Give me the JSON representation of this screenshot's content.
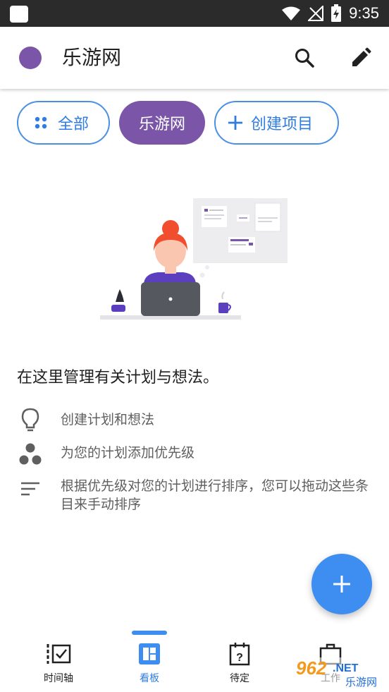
{
  "status_bar": {
    "time": "9:35"
  },
  "app_bar": {
    "title": "乐游网",
    "project_color": "#7b56a8",
    "search_icon": "search-icon",
    "edit_icon": "pencil-icon"
  },
  "chips": {
    "all": "全部",
    "project": "乐游网",
    "create": "创建项目"
  },
  "empty_state": {
    "heading": "在这里管理有关计划与想法。",
    "features": [
      {
        "icon": "lightbulb-icon",
        "text": "创建计划和想法"
      },
      {
        "icon": "priority-icon",
        "text": "为您的计划添加优先级"
      },
      {
        "icon": "sort-lines-icon",
        "text": "根据优先级对您的计划进行排序，您可以拖动这些条目来手动排序"
      }
    ]
  },
  "fab": {
    "icon": "plus-icon"
  },
  "bottom_nav": {
    "items": [
      {
        "label": "时间轴",
        "icon": "timeline-icon"
      },
      {
        "label": "看板",
        "icon": "board-icon",
        "active": true
      },
      {
        "label": "待定",
        "icon": "calendar-question-icon"
      },
      {
        "label": "工作",
        "icon": "briefcase-icon"
      }
    ]
  },
  "watermark": {
    "brand": "962.NET",
    "site": "乐游网"
  },
  "colors": {
    "accent": "#3d8ef0",
    "chip_border": "#4a90e2",
    "project": "#7b56a8"
  }
}
